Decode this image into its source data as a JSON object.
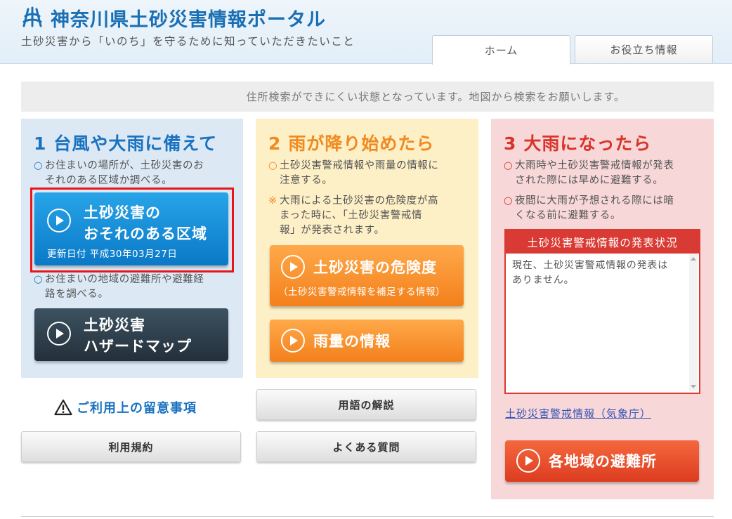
{
  "header": {
    "title": "神奈川県土砂災害情報ポータル",
    "subtitle": "土砂災害から「いのち」を守るために知っていただきたいこと",
    "logo_icon": "kanagawa-emblem-icon",
    "tabs": [
      {
        "label": "ホーム",
        "active": true
      },
      {
        "label": "お役立ち情報",
        "active": false
      }
    ]
  },
  "notice": {
    "text": "住所検索ができにくい状態となっています。地図から検索をお願いします。"
  },
  "panel1": {
    "number": "1",
    "title": "台風や大雨に備えて",
    "bullet1": [
      "お住まいの場所が、土砂災害のお",
      "それのある区域か調べる。"
    ],
    "bullet2": [
      "お住まいの地域の避難所や避難経",
      "路を調べる。"
    ],
    "btn_area": {
      "line1": "土砂災害の",
      "line2": "おそれのある区域",
      "updated": "更新日付 平成30年03月27日"
    },
    "btn_hazard": {
      "line1": "土砂災害",
      "line2": "ハザードマップ"
    }
  },
  "panel2": {
    "number": "2",
    "title": "雨が降り始めたら",
    "bullet1": [
      "土砂災害警戒情報や雨量の情報に",
      "注意する。"
    ],
    "note": [
      "大雨による土砂災害の危険度が高",
      "まった時に、「土砂災害警戒情",
      "報」が発表されます。"
    ],
    "btn_risk": {
      "line1": "土砂災害の危険度",
      "sub": "（土砂災害警戒情報を補足する情報）"
    },
    "btn_rain": {
      "line1": "雨量の情報"
    }
  },
  "panel3": {
    "number": "3",
    "title": "大雨になったら",
    "bullet1": [
      "大雨時や土砂災害警戒情報が発表",
      "された際には早めに避難する。"
    ],
    "bullet2": [
      "夜間に大雨が予想される際には暗",
      "くなる前に避難する。"
    ],
    "status_title": "土砂災害警戒情報の発表状況",
    "status_text": [
      "現在、土砂災害警戒情報の発表は",
      "ありません。"
    ],
    "jma_link": "土砂災害警戒情報（気象庁）",
    "btn_shelter": "各地域の避難所"
  },
  "bottom": {
    "caution": "ご利用上の留意事項",
    "terms": "利用規約",
    "glossary": "用語の解説",
    "faq": "よくある質問"
  },
  "marks": {
    "circle": "○",
    "note": "※"
  },
  "colors": {
    "blue": "#1a72c0",
    "orange": "#f08a1e",
    "red": "#d8342a",
    "highlight": "#e8151b"
  }
}
